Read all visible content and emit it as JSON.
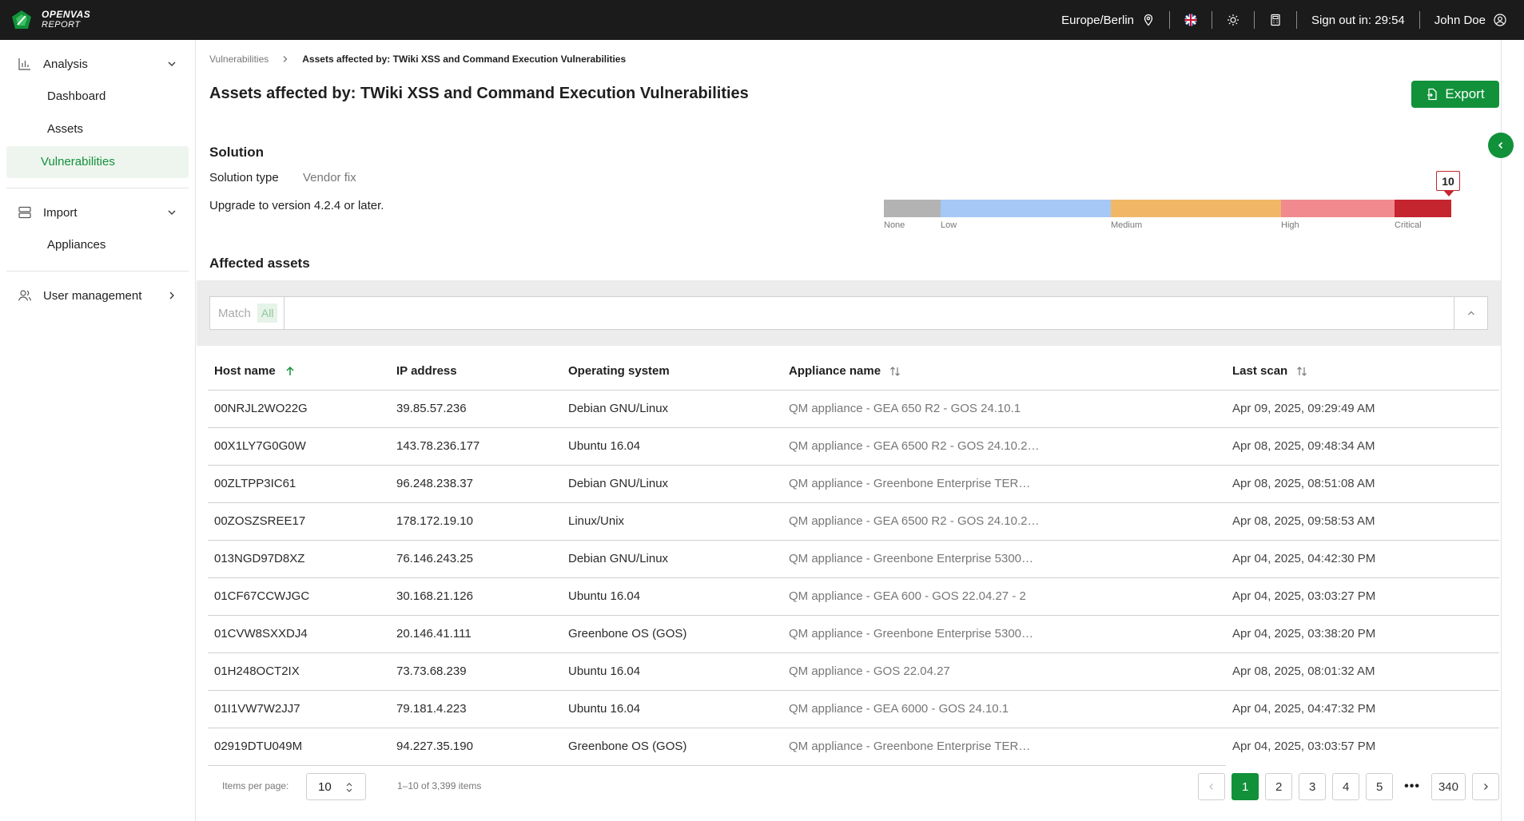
{
  "topbar": {
    "logo_line1": "OPENVAS",
    "logo_line2": "REPORT",
    "timezone": "Europe/Berlin",
    "signout": "Sign out in: 29:54",
    "user": "John Doe",
    "icons": [
      "location-icon",
      "flag-icon",
      "sun-icon",
      "calculator-icon",
      "user-icon"
    ]
  },
  "sidebar": {
    "groups": [
      {
        "label": "Analysis",
        "icon": "bar-chart-icon",
        "expanded": true,
        "items": [
          "Dashboard",
          "Assets",
          "Vulnerabilities"
        ]
      },
      {
        "label": "Import",
        "icon": "server-icon",
        "expanded": true,
        "items": [
          "Appliances"
        ]
      },
      {
        "label": "User management",
        "icon": "users-icon",
        "expanded": false,
        "items": []
      }
    ],
    "active_item": "Vulnerabilities"
  },
  "breadcrumb": {
    "parent": "Vulnerabilities",
    "current": "Assets affected by: TWiki XSS and Command Execution Vulnerabilities"
  },
  "page": {
    "title": "Assets affected by: TWiki XSS and Command Execution Vulnerabilities",
    "export_label": "Export"
  },
  "solution": {
    "title": "Solution",
    "type_label": "Solution type",
    "type_value": "Vendor fix",
    "text": "Upgrade to version 4.2.4 or later."
  },
  "severity": {
    "score": "10",
    "labels": [
      "None",
      "Low",
      "Medium",
      "High",
      "Critical"
    ],
    "colors": {
      "none": "#b3b3b3",
      "low": "#a6c8f7",
      "medium": "#f2b766",
      "high": "#f08a8e",
      "critical": "#c4252e"
    }
  },
  "affected": {
    "title": "Affected assets",
    "filter": {
      "match_label": "Match",
      "mode": "All"
    },
    "columns": [
      "Host name",
      "IP address",
      "Operating system",
      "Appliance name",
      "Last scan"
    ],
    "rows": [
      [
        "00NRJL2WO22G",
        "39.85.57.236",
        "Debian GNU/Linux",
        "QM appliance - GEA 650 R2 - GOS 24.10.1",
        "Apr 09, 2025, 09:29:49 AM"
      ],
      [
        "00X1LY7G0G0W",
        "143.78.236.177",
        "Ubuntu 16.04",
        "QM appliance - GEA 6500 R2 - GOS 24.10.2…",
        "Apr 08, 2025, 09:48:34 AM"
      ],
      [
        "00ZLTPP3IC61",
        "96.248.238.37",
        "Debian GNU/Linux",
        "QM appliance - Greenbone Enterprise TER…",
        "Apr 08, 2025, 08:51:08 AM"
      ],
      [
        "00ZOSZSREE17",
        "178.172.19.10",
        "Linux/Unix",
        "QM appliance - GEA 6500 R2 - GOS 24.10.2…",
        "Apr 08, 2025, 09:58:53 AM"
      ],
      [
        "013NGD97D8XZ",
        "76.146.243.25",
        "Debian GNU/Linux",
        "QM appliance - Greenbone Enterprise 5300…",
        "Apr 04, 2025, 04:42:30 PM"
      ],
      [
        "01CF67CCWJGC",
        "30.168.21.126",
        "Ubuntu 16.04",
        "QM appliance - GEA 600 - GOS 22.04.27 - 2",
        "Apr 04, 2025, 03:03:27 PM"
      ],
      [
        "01CVW8SXXDJ4",
        "20.146.41.111",
        "Greenbone OS (GOS)",
        "QM appliance - Greenbone Enterprise 5300…",
        "Apr 04, 2025, 03:38:20 PM"
      ],
      [
        "01H248OCT2IX",
        "73.73.68.239",
        "Ubuntu 16.04",
        "QM appliance - GOS 22.04.27",
        "Apr 08, 2025, 08:01:32 AM"
      ],
      [
        "01I1VW7W2JJ7",
        "79.181.4.223",
        "Ubuntu 16.04",
        "QM appliance - GEA 6000 - GOS 24.10.1",
        "Apr 04, 2025, 04:47:32 PM"
      ],
      [
        "02919DTU049M",
        "94.227.35.190",
        "Greenbone OS (GOS)",
        "QM appliance - Greenbone Enterprise TER…",
        "Apr 04, 2025, 03:03:57 PM"
      ]
    ]
  },
  "pagination": {
    "items_per_page_label": "Items per page:",
    "items_per_page": "10",
    "range": "1–10 of 3,399 items",
    "pages": [
      "1",
      "2",
      "3",
      "4",
      "5"
    ],
    "ellipsis": "•••",
    "last_page": "340",
    "current": "1"
  }
}
